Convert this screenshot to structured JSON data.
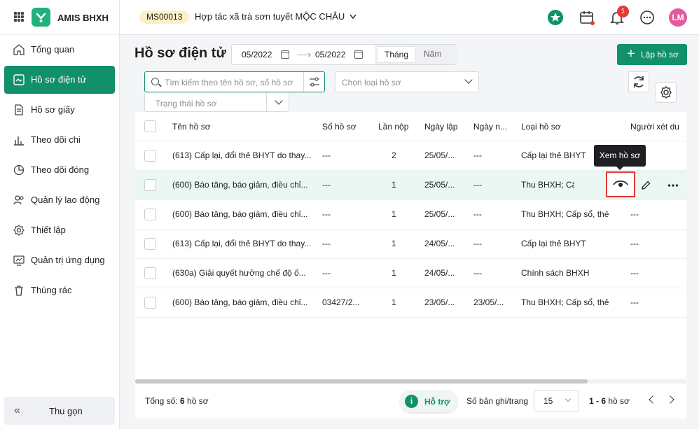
{
  "app": {
    "name": "AMIS BHXH"
  },
  "sidebar": {
    "items": [
      {
        "label": "Tổng quan",
        "icon": "home-icon"
      },
      {
        "label": "Hồ sơ điện tử",
        "icon": "electronic-record-icon",
        "active": true
      },
      {
        "label": "Hồ sơ giấy",
        "icon": "paper-document-icon"
      },
      {
        "label": "Theo dõi chi",
        "icon": "bar-chart-icon"
      },
      {
        "label": "Theo dõi đóng",
        "icon": "pie-chart-icon"
      },
      {
        "label": "Quản lý lao động",
        "icon": "people-icon"
      },
      {
        "label": "Thiết lập",
        "icon": "settings-gear-icon"
      },
      {
        "label": "Quản trị ứng dụng",
        "icon": "monitor-chart-icon"
      },
      {
        "label": "Thùng rác",
        "icon": "trash-icon"
      }
    ],
    "collapse_label": "Thu gọn"
  },
  "header": {
    "org_code": "MS00013",
    "org_name": "Hợp tác xã trà sơn tuyết MỘC CHÂU",
    "notification_count": "1",
    "avatar_initials": "LM"
  },
  "page": {
    "title": "Hồ sơ điện tử",
    "date_from": "05/2022",
    "date_to": "05/2022",
    "period_month": "Tháng",
    "period_year": "Năm",
    "create_label": "Lập hồ sơ"
  },
  "filters": {
    "search_placeholder": "Tìm kiếm theo tên hồ sơ, số hồ sơ",
    "type_placeholder": "Chọn loại hồ sơ",
    "status_placeholder": "Trạng thái hồ sơ"
  },
  "table": {
    "columns": [
      "Tên hồ sơ",
      "Số hồ sơ",
      "Lần nộp",
      "Ngày lập",
      "Ngày n...",
      "Loại hồ sơ",
      "Người xét du"
    ],
    "rows": [
      {
        "name": "(613) Cấp lại, đổi thẻ BHYT do thay...",
        "number": "---",
        "times": "2",
        "created": "25/05/...",
        "submitted": "---",
        "type": "Cấp lại thẻ BHYT",
        "reviewer": ""
      },
      {
        "name": "(600) Báo tăng, báo giảm, điều chỉ...",
        "number": "---",
        "times": "1",
        "created": "25/05/...",
        "submitted": "---",
        "type": "Thu BHXH; Cấ",
        "reviewer": ""
      },
      {
        "name": "(600) Báo tăng, báo giảm, điều chỉ...",
        "number": "---",
        "times": "1",
        "created": "25/05/...",
        "submitted": "---",
        "type": "Thu BHXH; Cấp sổ, thẻ",
        "reviewer": "---"
      },
      {
        "name": "(613) Cấp lại, đổi thẻ BHYT do thay...",
        "number": "---",
        "times": "1",
        "created": "24/05/...",
        "submitted": "---",
        "type": "Cấp lại thẻ BHYT",
        "reviewer": "---"
      },
      {
        "name": "(630a) Giải quyết hưởng chế độ ố...",
        "number": "---",
        "times": "1",
        "created": "24/05/...",
        "submitted": "---",
        "type": "Chính sách BHXH",
        "reviewer": "---"
      },
      {
        "name": "(600) Báo tăng, báo giảm, điều chỉ...",
        "number": "03427/2...",
        "times": "1",
        "created": "23/05/...",
        "submitted": "23/05/...",
        "type": "Thu BHXH; Cấp sổ, thẻ",
        "reviewer": "---"
      }
    ],
    "tooltip": "Xem hồ sơ"
  },
  "footer": {
    "total_prefix": "Tổng số: ",
    "total_count": "6",
    "total_suffix": " hồ sơ",
    "help_label": "Hỗ trợ",
    "per_page_label": "Số bản ghi/trang",
    "per_page_value": "15",
    "range": "1 - 6",
    "range_suffix": " hồ sơ"
  },
  "colors": {
    "primary": "#11906a",
    "highlight": "#e53935",
    "tag": "#fdf0c6",
    "avatar": "#e7599f"
  }
}
